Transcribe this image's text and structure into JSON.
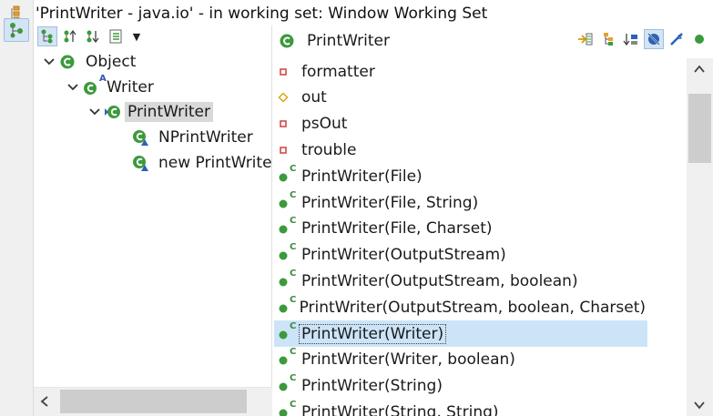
{
  "window": {
    "title": "'PrintWriter - java.io' - in working set: Window Working Set"
  },
  "side_rail": {
    "items": [
      {
        "icon": "type-hierarchy-icon"
      },
      {
        "icon": "supertype-hierarchy-icon",
        "active": true
      }
    ]
  },
  "left_toolbar": {
    "buttons": [
      {
        "icon": "show-type-hierarchy-icon",
        "active": true
      },
      {
        "icon": "show-supertype-hierarchy-icon"
      },
      {
        "icon": "show-subtype-hierarchy-icon"
      },
      {
        "icon": "history-list-icon"
      }
    ],
    "menu_icon": "view-menu-chevron-icon"
  },
  "tree": {
    "nodes": [
      {
        "label": "Object",
        "expanded": true
      },
      {
        "label": "Writer",
        "expanded": true,
        "abstract_marker": "A"
      },
      {
        "label": "PrintWriter",
        "expanded": true,
        "selected": true
      },
      {
        "label": "NPrintWriter"
      },
      {
        "label": "new PrintWriter() {...}"
      }
    ]
  },
  "right_pane": {
    "title": "PrintWriter",
    "tool_icons": [
      "show-inherited-members-icon",
      "sort-by-defining-type-icon",
      "sort-members-icon",
      "hide-fields-icon",
      "hide-static-members-icon",
      "hide-non-public-members-icon"
    ],
    "constructor_marker": "C",
    "members": [
      {
        "label": "formatter",
        "kind": "field-protected"
      },
      {
        "label": "out",
        "kind": "field-protected-diamond"
      },
      {
        "label": "psOut",
        "kind": "field-private"
      },
      {
        "label": "trouble",
        "kind": "field-private"
      },
      {
        "label": "PrintWriter(File)",
        "kind": "constructor"
      },
      {
        "label": "PrintWriter(File, String)",
        "kind": "constructor"
      },
      {
        "label": "PrintWriter(File, Charset)",
        "kind": "constructor"
      },
      {
        "label": "PrintWriter(OutputStream)",
        "kind": "constructor"
      },
      {
        "label": "PrintWriter(OutputStream, boolean)",
        "kind": "constructor"
      },
      {
        "label": "PrintWriter(OutputStream, boolean, Charset)",
        "kind": "constructor"
      },
      {
        "label": "PrintWriter(Writer)",
        "kind": "constructor",
        "selected": true
      },
      {
        "label": "PrintWriter(Writer, boolean)",
        "kind": "constructor"
      },
      {
        "label": "PrintWriter(String)",
        "kind": "constructor"
      },
      {
        "label": "PrintWriter(String, String)",
        "kind": "constructor"
      }
    ]
  },
  "colors": {
    "selection": "#cce4f7",
    "class_green": "#3c9a3c",
    "field_red": "#d04a4a",
    "field_diamond": "#d9a400"
  }
}
